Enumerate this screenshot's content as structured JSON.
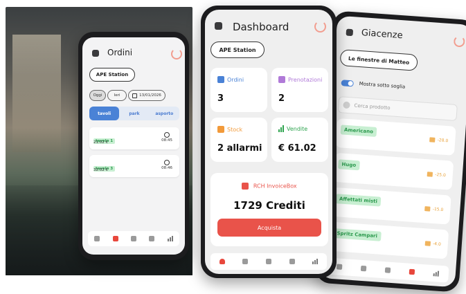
{
  "ordini": {
    "title": "Ordini",
    "location": "APE Station",
    "filters": {
      "today": "Oggi",
      "yesterday": "Ieri",
      "date": "13/01/2026"
    },
    "segments": [
      "tavoli",
      "park",
      "asporto"
    ],
    "orders": [
      {
        "name": "tavolo 1",
        "amount": "21.02 €",
        "time": "08:45"
      },
      {
        "name": "tavolo 3",
        "amount": "32.02 €",
        "time": "08:46"
      }
    ]
  },
  "dashboard": {
    "title": "Dashboard",
    "location": "APE Station",
    "cards": {
      "ordini": {
        "label": "Ordini",
        "value": "3",
        "color": "#4a82d6"
      },
      "prenotazioni": {
        "label": "Prenotazioni",
        "value": "2",
        "color": "#b07ad8"
      },
      "stock": {
        "label": "Stock",
        "value": "2 allarmi",
        "color": "#f29a3a"
      },
      "vendite": {
        "label": "Vendite",
        "value": "€ 61.02",
        "color": "#2ea44f"
      }
    },
    "invoice": {
      "label": "RCH InvoiceBox",
      "credits": "1729 Crediti",
      "button": "Acquista",
      "accent": "#e9534a"
    }
  },
  "giacenze": {
    "title": "Giacenze",
    "location": "Le finestre di Matteo",
    "toggle_label": "Mostra sotto soglia",
    "search_placeholder": "Cerca prodotto",
    "items": [
      {
        "name": "Americano",
        "qty": "-28.0"
      },
      {
        "name": "Hugo",
        "qty": "-25.0"
      },
      {
        "name": "Affettati misti",
        "qty": "-15.0"
      },
      {
        "name": "Spritz Campari",
        "qty": "-4.0"
      }
    ]
  }
}
